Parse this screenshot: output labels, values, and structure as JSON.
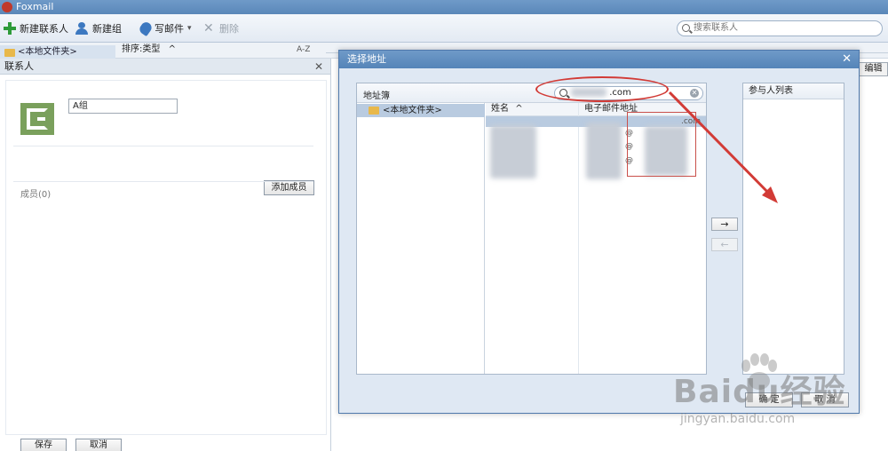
{
  "app": {
    "title": "Foxmail"
  },
  "toolbar": {
    "new_contact": "新建联系人",
    "new_group": "新建组",
    "write_mail": "写邮件",
    "write_mail_caret": "▾",
    "delete": "删除",
    "search_placeholder": "搜索联系人"
  },
  "folder_bar": {
    "folder": "<本地文件夹>",
    "sort_label": "排序:类型",
    "sort_caret": "^",
    "az": "A-Z"
  },
  "contact_panel": {
    "title": "联系人",
    "close": "✕",
    "group_name_value": "A组",
    "members_label": "成员(0)",
    "add_member": "添加成员",
    "save": "保存",
    "cancel": "取消"
  },
  "background": {
    "edit_button": "编辑"
  },
  "dialog": {
    "title": "选择地址",
    "close": "✕",
    "address_book_title": "地址簿",
    "search_value": ".com",
    "folder": "<本地文件夹>",
    "col_name": "姓名",
    "col_name_sort": "^",
    "col_email": "电子邮件地址",
    "email_fragments": [
      "@",
      "@",
      "@",
      ".com"
    ],
    "add_arrow": "→",
    "remove_arrow": "←",
    "participants_title": "参与人列表",
    "ok": "确 定",
    "cancel": "取 消"
  },
  "watermark": {
    "main": "Baidu经验",
    "sub": "jingyan.baidu.com"
  },
  "colors": {
    "titlebar": "#5a87b9",
    "annotation_red": "#d23b36",
    "selection": "#b9cbe0"
  }
}
